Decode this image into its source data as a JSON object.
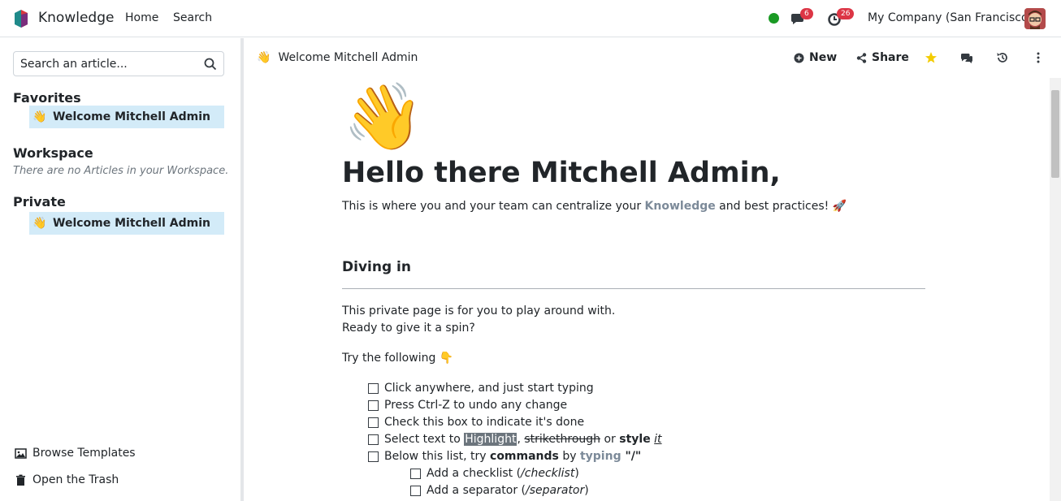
{
  "app": {
    "name": "Knowledge"
  },
  "nav": {
    "home": "Home",
    "search": "Search"
  },
  "systray": {
    "messages_count": "6",
    "activities_count": "26",
    "company": "My Company (San Francisco)"
  },
  "sidebar": {
    "search_placeholder": "Search an article...",
    "favorites": {
      "title": "Favorites",
      "items": [
        {
          "emoji": "👋",
          "label": "Welcome Mitchell Admin"
        }
      ]
    },
    "workspace": {
      "title": "Workspace",
      "empty": "There are no Articles in your Workspace."
    },
    "private": {
      "title": "Private",
      "items": [
        {
          "emoji": "👋",
          "label": "Welcome Mitchell Admin"
        }
      ]
    },
    "footer": {
      "browse_templates": "Browse Templates",
      "open_trash": "Open the Trash"
    }
  },
  "header": {
    "breadcrumb_emoji": "👋",
    "breadcrumb_title": "Welcome Mitchell Admin",
    "new_label": "New",
    "share_label": "Share"
  },
  "article": {
    "emoji": "👋",
    "title": "Hello there Mitchell Admin,",
    "intro_before": "This is where you and your team can centralize your ",
    "intro_keyword": "Knowledge",
    "intro_after": " and best practices! 🚀",
    "section_heading": "Diving in",
    "para1_line1": "This private page is for you to play around with.",
    "para1_line2": "Ready to give it a spin?",
    "try_following": "Try the following 👇",
    "checklist": {
      "item1": "Click anywhere, and just start typing",
      "item2": "Press Ctrl-Z to undo any change",
      "item3": "Check this box to indicate it's done",
      "item4_a": "Select text to ",
      "item4_highlight": "Highlight",
      "item4_comma": ", ",
      "item4_strike": "strikethrough",
      "item4_or": " or ",
      "item4_style": "style",
      "item4_space": " ",
      "item4_it": "it",
      "item5_a": "Below this list, try ",
      "item5_commands": "commands",
      "item5_by": " by ",
      "item5_typing": "typing",
      "item5_quote": " \"/\"",
      "sub1_a": "Add a checklist (",
      "sub1_cmd": "/checklist",
      "sub1_b": ")",
      "sub2_a": "Add a separator (",
      "sub2_cmd": "/separator",
      "sub2_b": ")"
    }
  },
  "colors": {
    "accent_blue": "#d3ebf8",
    "status_green": "#1a9a24",
    "badge_red": "#dc3545",
    "star_yellow": "#f3cc00"
  }
}
